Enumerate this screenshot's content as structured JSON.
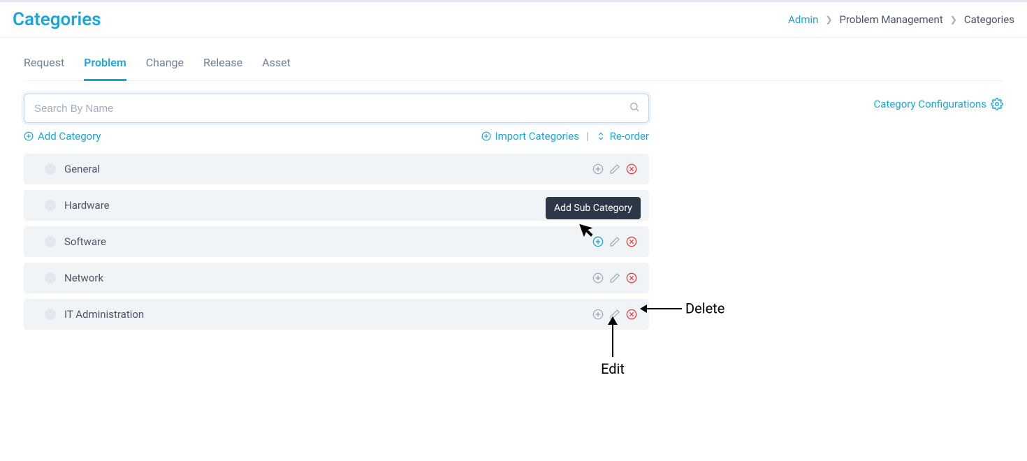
{
  "header": {
    "title": "Categories",
    "breadcrumb": {
      "admin": "Admin",
      "module": "Problem Management",
      "page": "Categories"
    }
  },
  "tabs": [
    {
      "label": "Request",
      "active": false
    },
    {
      "label": "Problem",
      "active": true
    },
    {
      "label": "Change",
      "active": false
    },
    {
      "label": "Release",
      "active": false
    },
    {
      "label": "Asset",
      "active": false
    }
  ],
  "search": {
    "placeholder": "Search By Name",
    "value": ""
  },
  "toolbar": {
    "add_category": "Add Category",
    "import_categories": "Import Categories",
    "reorder": "Re-order"
  },
  "config_link": "Category Configurations",
  "tooltip": {
    "add_sub": "Add Sub Category"
  },
  "categories": [
    {
      "name": "General"
    },
    {
      "name": "Hardware"
    },
    {
      "name": "Software"
    },
    {
      "name": "Network"
    },
    {
      "name": "IT Administration"
    }
  ],
  "annotations": {
    "delete": "Delete",
    "edit": "Edit"
  }
}
